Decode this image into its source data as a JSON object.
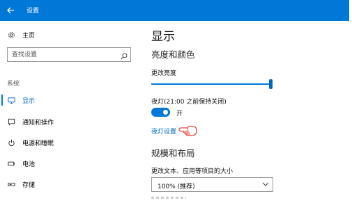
{
  "window": {
    "title": "设置"
  },
  "sidebar": {
    "home_label": "主页",
    "search_placeholder": "查找设置",
    "section_label": "系统",
    "items": [
      {
        "label": "显示",
        "icon": "monitor-icon",
        "active": true
      },
      {
        "label": "通知和操作",
        "icon": "notification-icon",
        "active": false
      },
      {
        "label": "电源和睡眠",
        "icon": "power-icon",
        "active": false
      },
      {
        "label": "电池",
        "icon": "battery-icon",
        "active": false
      },
      {
        "label": "存储",
        "icon": "storage-icon",
        "active": false
      }
    ]
  },
  "main": {
    "title": "显示",
    "brightness_section": "亮度和颜色",
    "brightness_label": "更改亮度",
    "brightness_value": 1.0,
    "night_light_label": "夜灯(21:00 之前保持关闭)",
    "night_light_state": "开",
    "night_light_link": "夜灯设置",
    "scale_section": "规模和布局",
    "scale_label": "更改文本、应用等项目的大小",
    "scale_value": "100% (推荐)"
  },
  "colors": {
    "accent": "#0078d7",
    "link": "#0067c0"
  }
}
